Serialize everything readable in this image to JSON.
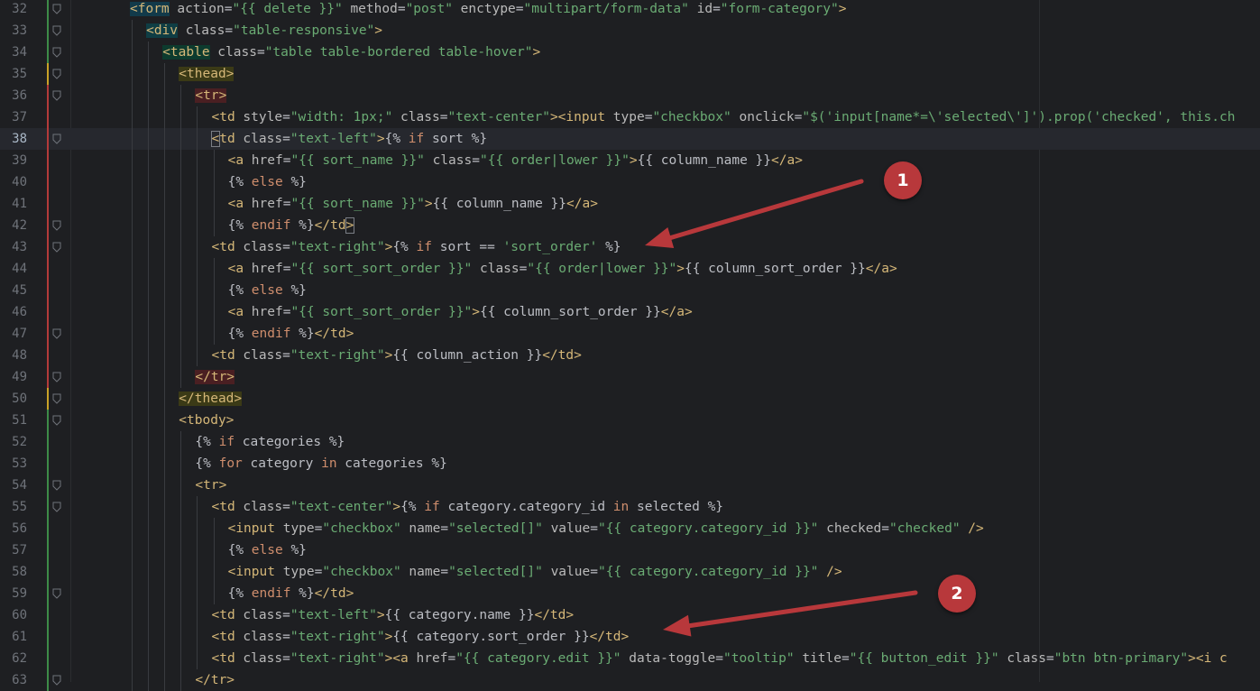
{
  "colors": {
    "background": "#1e1f22",
    "tag": "#d5b778",
    "attribute": "#bababa",
    "string": "#6aab73",
    "keyword": "#cf8e6d",
    "annotation": "#b8383b",
    "arrow": "#b8383b"
  },
  "current_line": 38,
  "lines": [
    {
      "n": "32",
      "indent": 8,
      "segs": [
        [
          "tag",
          "<form",
          true,
          "form"
        ],
        [
          "attr",
          " action"
        ],
        [
          "eq",
          "="
        ],
        [
          "str",
          "\"{{ delete }}\""
        ],
        [
          "attr",
          " method"
        ],
        [
          "eq",
          "="
        ],
        [
          "str",
          "\"post\""
        ],
        [
          "attr",
          " enctype"
        ],
        [
          "eq",
          "="
        ],
        [
          "str",
          "\"multipart/form-data\""
        ],
        [
          "attr",
          " id"
        ],
        [
          "eq",
          "="
        ],
        [
          "str",
          "\"form-category\""
        ],
        [
          "tag",
          ">"
        ]
      ]
    },
    {
      "n": "33",
      "indent": 9,
      "segs": [
        [
          "tag",
          "<div",
          true,
          "div"
        ],
        [
          "attr",
          " class"
        ],
        [
          "eq",
          "="
        ],
        [
          "str",
          "\"table-responsive\""
        ],
        [
          "tag",
          ">"
        ]
      ]
    },
    {
      "n": "34",
      "indent": 10,
      "segs": [
        [
          "tag",
          "<table",
          true,
          "table"
        ],
        [
          "attr",
          " class"
        ],
        [
          "eq",
          "="
        ],
        [
          "str",
          "\"table table-bordered table-hover\""
        ],
        [
          "tag",
          ">"
        ]
      ]
    },
    {
      "n": "35",
      "indent": 11,
      "segs": [
        [
          "tag",
          "<thead>",
          true,
          "thead"
        ]
      ]
    },
    {
      "n": "36",
      "indent": 12,
      "segs": [
        [
          "tag",
          "<tr>",
          true,
          "tr"
        ]
      ]
    },
    {
      "n": "37",
      "indent": 13,
      "segs": [
        [
          "tag",
          "<td"
        ],
        [
          "attr",
          " style"
        ],
        [
          "eq",
          "="
        ],
        [
          "str",
          "\"width: 1px;\""
        ],
        [
          "attr",
          " class"
        ],
        [
          "eq",
          "="
        ],
        [
          "str",
          "\"text-center\""
        ],
        [
          "tag",
          "><input"
        ],
        [
          "attr",
          " type"
        ],
        [
          "eq",
          "="
        ],
        [
          "str",
          "\"checkbox\""
        ],
        [
          "attr",
          " onclick"
        ],
        [
          "eq",
          "="
        ],
        [
          "str",
          "\"$('input[name*=\\'selected\\']').prop('checked', this.ch"
        ]
      ]
    },
    {
      "n": "38",
      "indent": 13,
      "segs": [
        [
          "tag",
          "<",
          true,
          "caret"
        ],
        [
          "tag",
          "td"
        ],
        [
          "attr",
          " class"
        ],
        [
          "eq",
          "="
        ],
        [
          "str",
          "\"text-left\""
        ],
        [
          "tag",
          ">"
        ],
        [
          "tpl",
          "{% "
        ],
        [
          "kw",
          "if"
        ],
        [
          "tpl",
          " sort %}"
        ]
      ]
    },
    {
      "n": "39",
      "indent": 14,
      "segs": [
        [
          "tag",
          "<a"
        ],
        [
          "attr",
          " href"
        ],
        [
          "eq",
          "="
        ],
        [
          "str",
          "\"{{ sort_name }}\""
        ],
        [
          "attr",
          " class"
        ],
        [
          "eq",
          "="
        ],
        [
          "str",
          "\"{{ order|lower }}\""
        ],
        [
          "tag",
          ">"
        ],
        [
          "tpl",
          "{{ column_name }}"
        ],
        [
          "tag",
          "</a>"
        ]
      ]
    },
    {
      "n": "40",
      "indent": 14,
      "segs": [
        [
          "tpl",
          "{% "
        ],
        [
          "kw",
          "else"
        ],
        [
          "tpl",
          " %}"
        ]
      ]
    },
    {
      "n": "41",
      "indent": 14,
      "segs": [
        [
          "tag",
          "<a"
        ],
        [
          "attr",
          " href"
        ],
        [
          "eq",
          "="
        ],
        [
          "str",
          "\"{{ sort_name }}\""
        ],
        [
          "tag",
          ">"
        ],
        [
          "tpl",
          "{{ column_name }}"
        ],
        [
          "tag",
          "</a>"
        ]
      ]
    },
    {
      "n": "42",
      "indent": 14,
      "segs": [
        [
          "tpl",
          "{% "
        ],
        [
          "kw",
          "endif"
        ],
        [
          "tpl",
          " %}"
        ],
        [
          "tag",
          "</td"
        ],
        [
          "tag",
          ">",
          true,
          "caret"
        ]
      ]
    },
    {
      "n": "43",
      "indent": 13,
      "segs": [
        [
          "tag",
          "<td"
        ],
        [
          "attr",
          " class"
        ],
        [
          "eq",
          "="
        ],
        [
          "str",
          "\"text-right\""
        ],
        [
          "tag",
          ">"
        ],
        [
          "tpl",
          "{% "
        ],
        [
          "kw",
          "if"
        ],
        [
          "tpl",
          " sort == "
        ],
        [
          "str",
          "'sort_order'"
        ],
        [
          "tpl",
          " %}"
        ]
      ]
    },
    {
      "n": "44",
      "indent": 14,
      "segs": [
        [
          "tag",
          "<a"
        ],
        [
          "attr",
          " href"
        ],
        [
          "eq",
          "="
        ],
        [
          "str",
          "\"{{ sort_sort_order }}\""
        ],
        [
          "attr",
          " class"
        ],
        [
          "eq",
          "="
        ],
        [
          "str",
          "\"{{ order|lower }}\""
        ],
        [
          "tag",
          ">"
        ],
        [
          "tpl",
          "{{ column_sort_order }}"
        ],
        [
          "tag",
          "</a>"
        ]
      ]
    },
    {
      "n": "45",
      "indent": 14,
      "segs": [
        [
          "tpl",
          "{% "
        ],
        [
          "kw",
          "else"
        ],
        [
          "tpl",
          " %}"
        ]
      ]
    },
    {
      "n": "46",
      "indent": 14,
      "segs": [
        [
          "tag",
          "<a"
        ],
        [
          "attr",
          " href"
        ],
        [
          "eq",
          "="
        ],
        [
          "str",
          "\"{{ sort_sort_order }}\""
        ],
        [
          "tag",
          ">"
        ],
        [
          "tpl",
          "{{ column_sort_order }}"
        ],
        [
          "tag",
          "</a>"
        ]
      ]
    },
    {
      "n": "47",
      "indent": 14,
      "segs": [
        [
          "tpl",
          "{% "
        ],
        [
          "kw",
          "endif"
        ],
        [
          "tpl",
          " %}"
        ],
        [
          "tag",
          "</td>"
        ]
      ]
    },
    {
      "n": "48",
      "indent": 13,
      "segs": [
        [
          "tag",
          "<td"
        ],
        [
          "attr",
          " class"
        ],
        [
          "eq",
          "="
        ],
        [
          "str",
          "\"text-right\""
        ],
        [
          "tag",
          ">"
        ],
        [
          "tpl",
          "{{ column_action }}"
        ],
        [
          "tag",
          "</td>"
        ]
      ]
    },
    {
      "n": "49",
      "indent": 12,
      "segs": [
        [
          "tag",
          "</tr>",
          true,
          "tr"
        ]
      ]
    },
    {
      "n": "50",
      "indent": 11,
      "segs": [
        [
          "tag",
          "</thead>",
          true,
          "thead"
        ]
      ]
    },
    {
      "n": "51",
      "indent": 11,
      "segs": [
        [
          "tag",
          "<tbody>"
        ]
      ]
    },
    {
      "n": "52",
      "indent": 12,
      "segs": [
        [
          "tpl",
          "{% "
        ],
        [
          "kw",
          "if"
        ],
        [
          "tpl",
          " categories %}"
        ]
      ]
    },
    {
      "n": "53",
      "indent": 12,
      "segs": [
        [
          "tpl",
          "{% "
        ],
        [
          "kw",
          "for"
        ],
        [
          "tpl",
          " category "
        ],
        [
          "kw",
          "in"
        ],
        [
          "tpl",
          " categories %}"
        ]
      ]
    },
    {
      "n": "54",
      "indent": 12,
      "segs": [
        [
          "tag",
          "<tr>"
        ]
      ]
    },
    {
      "n": "55",
      "indent": 13,
      "segs": [
        [
          "tag",
          "<td"
        ],
        [
          "attr",
          " class"
        ],
        [
          "eq",
          "="
        ],
        [
          "str",
          "\"text-center\""
        ],
        [
          "tag",
          ">"
        ],
        [
          "tpl",
          "{% "
        ],
        [
          "kw",
          "if"
        ],
        [
          "tpl",
          " category.category_id "
        ],
        [
          "kw",
          "in"
        ],
        [
          "tpl",
          " selected %}"
        ]
      ]
    },
    {
      "n": "56",
      "indent": 14,
      "segs": [
        [
          "tag",
          "<input"
        ],
        [
          "attr",
          " type"
        ],
        [
          "eq",
          "="
        ],
        [
          "str",
          "\"checkbox\""
        ],
        [
          "attr",
          " name"
        ],
        [
          "eq",
          "="
        ],
        [
          "str",
          "\"selected[]\""
        ],
        [
          "attr",
          " value"
        ],
        [
          "eq",
          "="
        ],
        [
          "str",
          "\"{{ category.category_id }}\""
        ],
        [
          "attr",
          " checked"
        ],
        [
          "eq",
          "="
        ],
        [
          "str",
          "\"checked\""
        ],
        [
          "tag",
          " />"
        ]
      ]
    },
    {
      "n": "57",
      "indent": 14,
      "segs": [
        [
          "tpl",
          "{% "
        ],
        [
          "kw",
          "else"
        ],
        [
          "tpl",
          " %}"
        ]
      ]
    },
    {
      "n": "58",
      "indent": 14,
      "segs": [
        [
          "tag",
          "<input"
        ],
        [
          "attr",
          " type"
        ],
        [
          "eq",
          "="
        ],
        [
          "str",
          "\"checkbox\""
        ],
        [
          "attr",
          " name"
        ],
        [
          "eq",
          "="
        ],
        [
          "str",
          "\"selected[]\""
        ],
        [
          "attr",
          " value"
        ],
        [
          "eq",
          "="
        ],
        [
          "str",
          "\"{{ category.category_id }}\""
        ],
        [
          "tag",
          " />"
        ]
      ]
    },
    {
      "n": "59",
      "indent": 14,
      "segs": [
        [
          "tpl",
          "{% "
        ],
        [
          "kw",
          "endif"
        ],
        [
          "tpl",
          " %}"
        ],
        [
          "tag",
          "</td>"
        ]
      ]
    },
    {
      "n": "60",
      "indent": 13,
      "segs": [
        [
          "tag",
          "<td"
        ],
        [
          "attr",
          " class"
        ],
        [
          "eq",
          "="
        ],
        [
          "str",
          "\"text-left\""
        ],
        [
          "tag",
          ">"
        ],
        [
          "tpl",
          "{{ category.name }}"
        ],
        [
          "tag",
          "</td>"
        ]
      ]
    },
    {
      "n": "61",
      "indent": 13,
      "segs": [
        [
          "tag",
          "<td"
        ],
        [
          "attr",
          " class"
        ],
        [
          "eq",
          "="
        ],
        [
          "str",
          "\"text-right\""
        ],
        [
          "tag",
          ">"
        ],
        [
          "tpl",
          "{{ category.sort_order }}"
        ],
        [
          "tag",
          "</td>"
        ]
      ]
    },
    {
      "n": "62",
      "indent": 13,
      "segs": [
        [
          "tag",
          "<td"
        ],
        [
          "attr",
          " class"
        ],
        [
          "eq",
          "="
        ],
        [
          "str",
          "\"text-right\""
        ],
        [
          "tag",
          "><a"
        ],
        [
          "attr",
          " href"
        ],
        [
          "eq",
          "="
        ],
        [
          "str",
          "\"{{ category.edit }}\""
        ],
        [
          "attr",
          " data-toggle"
        ],
        [
          "eq",
          "="
        ],
        [
          "str",
          "\"tooltip\""
        ],
        [
          "attr",
          " title"
        ],
        [
          "eq",
          "="
        ],
        [
          "str",
          "\"{{ button_edit }}\""
        ],
        [
          "attr",
          " class"
        ],
        [
          "eq",
          "="
        ],
        [
          "str",
          "\"btn btn-primary\""
        ],
        [
          "tag",
          "><i c"
        ]
      ]
    },
    {
      "n": "63",
      "indent": 12,
      "segs": [
        [
          "tag",
          "</tr>"
        ]
      ]
    }
  ],
  "annotations": [
    {
      "label": "1"
    },
    {
      "label": "2"
    }
  ]
}
